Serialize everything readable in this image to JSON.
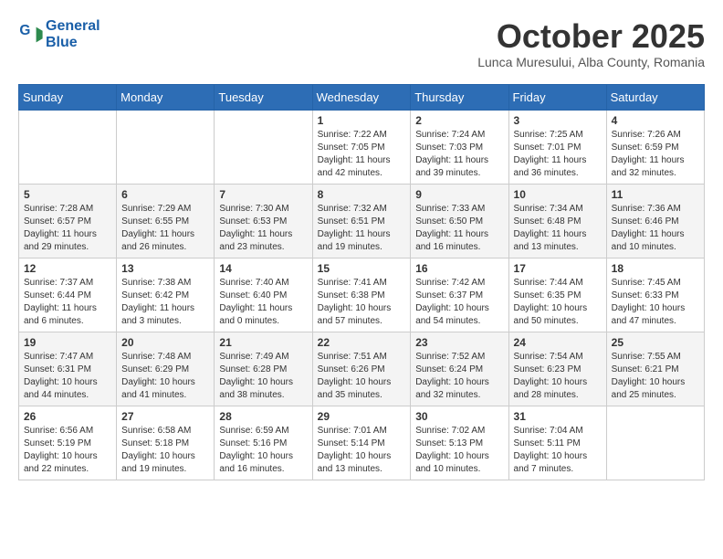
{
  "header": {
    "logo_line1": "General",
    "logo_line2": "Blue",
    "month": "October 2025",
    "location": "Lunca Muresului, Alba County, Romania"
  },
  "weekdays": [
    "Sunday",
    "Monday",
    "Tuesday",
    "Wednesday",
    "Thursday",
    "Friday",
    "Saturday"
  ],
  "weeks": [
    [
      {
        "day": "",
        "info": ""
      },
      {
        "day": "",
        "info": ""
      },
      {
        "day": "",
        "info": ""
      },
      {
        "day": "1",
        "info": "Sunrise: 7:22 AM\nSunset: 7:05 PM\nDaylight: 11 hours\nand 42 minutes."
      },
      {
        "day": "2",
        "info": "Sunrise: 7:24 AM\nSunset: 7:03 PM\nDaylight: 11 hours\nand 39 minutes."
      },
      {
        "day": "3",
        "info": "Sunrise: 7:25 AM\nSunset: 7:01 PM\nDaylight: 11 hours\nand 36 minutes."
      },
      {
        "day": "4",
        "info": "Sunrise: 7:26 AM\nSunset: 6:59 PM\nDaylight: 11 hours\nand 32 minutes."
      }
    ],
    [
      {
        "day": "5",
        "info": "Sunrise: 7:28 AM\nSunset: 6:57 PM\nDaylight: 11 hours\nand 29 minutes."
      },
      {
        "day": "6",
        "info": "Sunrise: 7:29 AM\nSunset: 6:55 PM\nDaylight: 11 hours\nand 26 minutes."
      },
      {
        "day": "7",
        "info": "Sunrise: 7:30 AM\nSunset: 6:53 PM\nDaylight: 11 hours\nand 23 minutes."
      },
      {
        "day": "8",
        "info": "Sunrise: 7:32 AM\nSunset: 6:51 PM\nDaylight: 11 hours\nand 19 minutes."
      },
      {
        "day": "9",
        "info": "Sunrise: 7:33 AM\nSunset: 6:50 PM\nDaylight: 11 hours\nand 16 minutes."
      },
      {
        "day": "10",
        "info": "Sunrise: 7:34 AM\nSunset: 6:48 PM\nDaylight: 11 hours\nand 13 minutes."
      },
      {
        "day": "11",
        "info": "Sunrise: 7:36 AM\nSunset: 6:46 PM\nDaylight: 11 hours\nand 10 minutes."
      }
    ],
    [
      {
        "day": "12",
        "info": "Sunrise: 7:37 AM\nSunset: 6:44 PM\nDaylight: 11 hours\nand 6 minutes."
      },
      {
        "day": "13",
        "info": "Sunrise: 7:38 AM\nSunset: 6:42 PM\nDaylight: 11 hours\nand 3 minutes."
      },
      {
        "day": "14",
        "info": "Sunrise: 7:40 AM\nSunset: 6:40 PM\nDaylight: 11 hours\nand 0 minutes."
      },
      {
        "day": "15",
        "info": "Sunrise: 7:41 AM\nSunset: 6:38 PM\nDaylight: 10 hours\nand 57 minutes."
      },
      {
        "day": "16",
        "info": "Sunrise: 7:42 AM\nSunset: 6:37 PM\nDaylight: 10 hours\nand 54 minutes."
      },
      {
        "day": "17",
        "info": "Sunrise: 7:44 AM\nSunset: 6:35 PM\nDaylight: 10 hours\nand 50 minutes."
      },
      {
        "day": "18",
        "info": "Sunrise: 7:45 AM\nSunset: 6:33 PM\nDaylight: 10 hours\nand 47 minutes."
      }
    ],
    [
      {
        "day": "19",
        "info": "Sunrise: 7:47 AM\nSunset: 6:31 PM\nDaylight: 10 hours\nand 44 minutes."
      },
      {
        "day": "20",
        "info": "Sunrise: 7:48 AM\nSunset: 6:29 PM\nDaylight: 10 hours\nand 41 minutes."
      },
      {
        "day": "21",
        "info": "Sunrise: 7:49 AM\nSunset: 6:28 PM\nDaylight: 10 hours\nand 38 minutes."
      },
      {
        "day": "22",
        "info": "Sunrise: 7:51 AM\nSunset: 6:26 PM\nDaylight: 10 hours\nand 35 minutes."
      },
      {
        "day": "23",
        "info": "Sunrise: 7:52 AM\nSunset: 6:24 PM\nDaylight: 10 hours\nand 32 minutes."
      },
      {
        "day": "24",
        "info": "Sunrise: 7:54 AM\nSunset: 6:23 PM\nDaylight: 10 hours\nand 28 minutes."
      },
      {
        "day": "25",
        "info": "Sunrise: 7:55 AM\nSunset: 6:21 PM\nDaylight: 10 hours\nand 25 minutes."
      }
    ],
    [
      {
        "day": "26",
        "info": "Sunrise: 6:56 AM\nSunset: 5:19 PM\nDaylight: 10 hours\nand 22 minutes."
      },
      {
        "day": "27",
        "info": "Sunrise: 6:58 AM\nSunset: 5:18 PM\nDaylight: 10 hours\nand 19 minutes."
      },
      {
        "day": "28",
        "info": "Sunrise: 6:59 AM\nSunset: 5:16 PM\nDaylight: 10 hours\nand 16 minutes."
      },
      {
        "day": "29",
        "info": "Sunrise: 7:01 AM\nSunset: 5:14 PM\nDaylight: 10 hours\nand 13 minutes."
      },
      {
        "day": "30",
        "info": "Sunrise: 7:02 AM\nSunset: 5:13 PM\nDaylight: 10 hours\nand 10 minutes."
      },
      {
        "day": "31",
        "info": "Sunrise: 7:04 AM\nSunset: 5:11 PM\nDaylight: 10 hours\nand 7 minutes."
      },
      {
        "day": "",
        "info": ""
      }
    ]
  ]
}
